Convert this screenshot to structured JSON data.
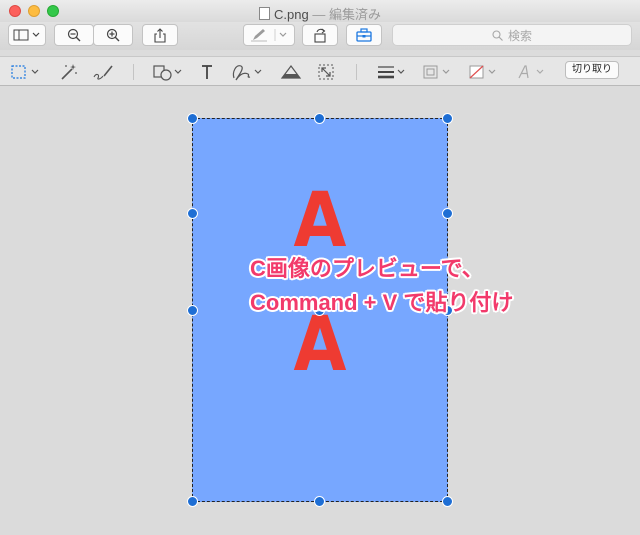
{
  "window": {
    "filename": "C.png",
    "separator": "—",
    "status": "編集済み"
  },
  "toolbar": {
    "search_placeholder": "検索",
    "cut_label": "切り取り"
  },
  "canvas": {
    "letter_top": "A",
    "letter_bottom": "A",
    "image_color": "#77a7ff",
    "letter_color": "#ee3b32"
  },
  "annotation": {
    "line1": "C画像のプレビューで、",
    "line2": "Command + V で貼り付け",
    "color": "#f23a6b"
  },
  "icons": [
    "sidebar-icon",
    "zoom-out-icon",
    "zoom-in-icon",
    "share-icon",
    "markup-pen-icon",
    "rotate-icon",
    "toolbox-icon",
    "search-icon",
    "rect-selection-icon",
    "magic-wand-icon",
    "sketch-icon",
    "shapes-icon",
    "text-icon",
    "signature-icon",
    "adjust-color-icon",
    "adjust-size-icon",
    "line-style-icon",
    "border-color-icon",
    "fill-color-icon",
    "font-icon"
  ]
}
